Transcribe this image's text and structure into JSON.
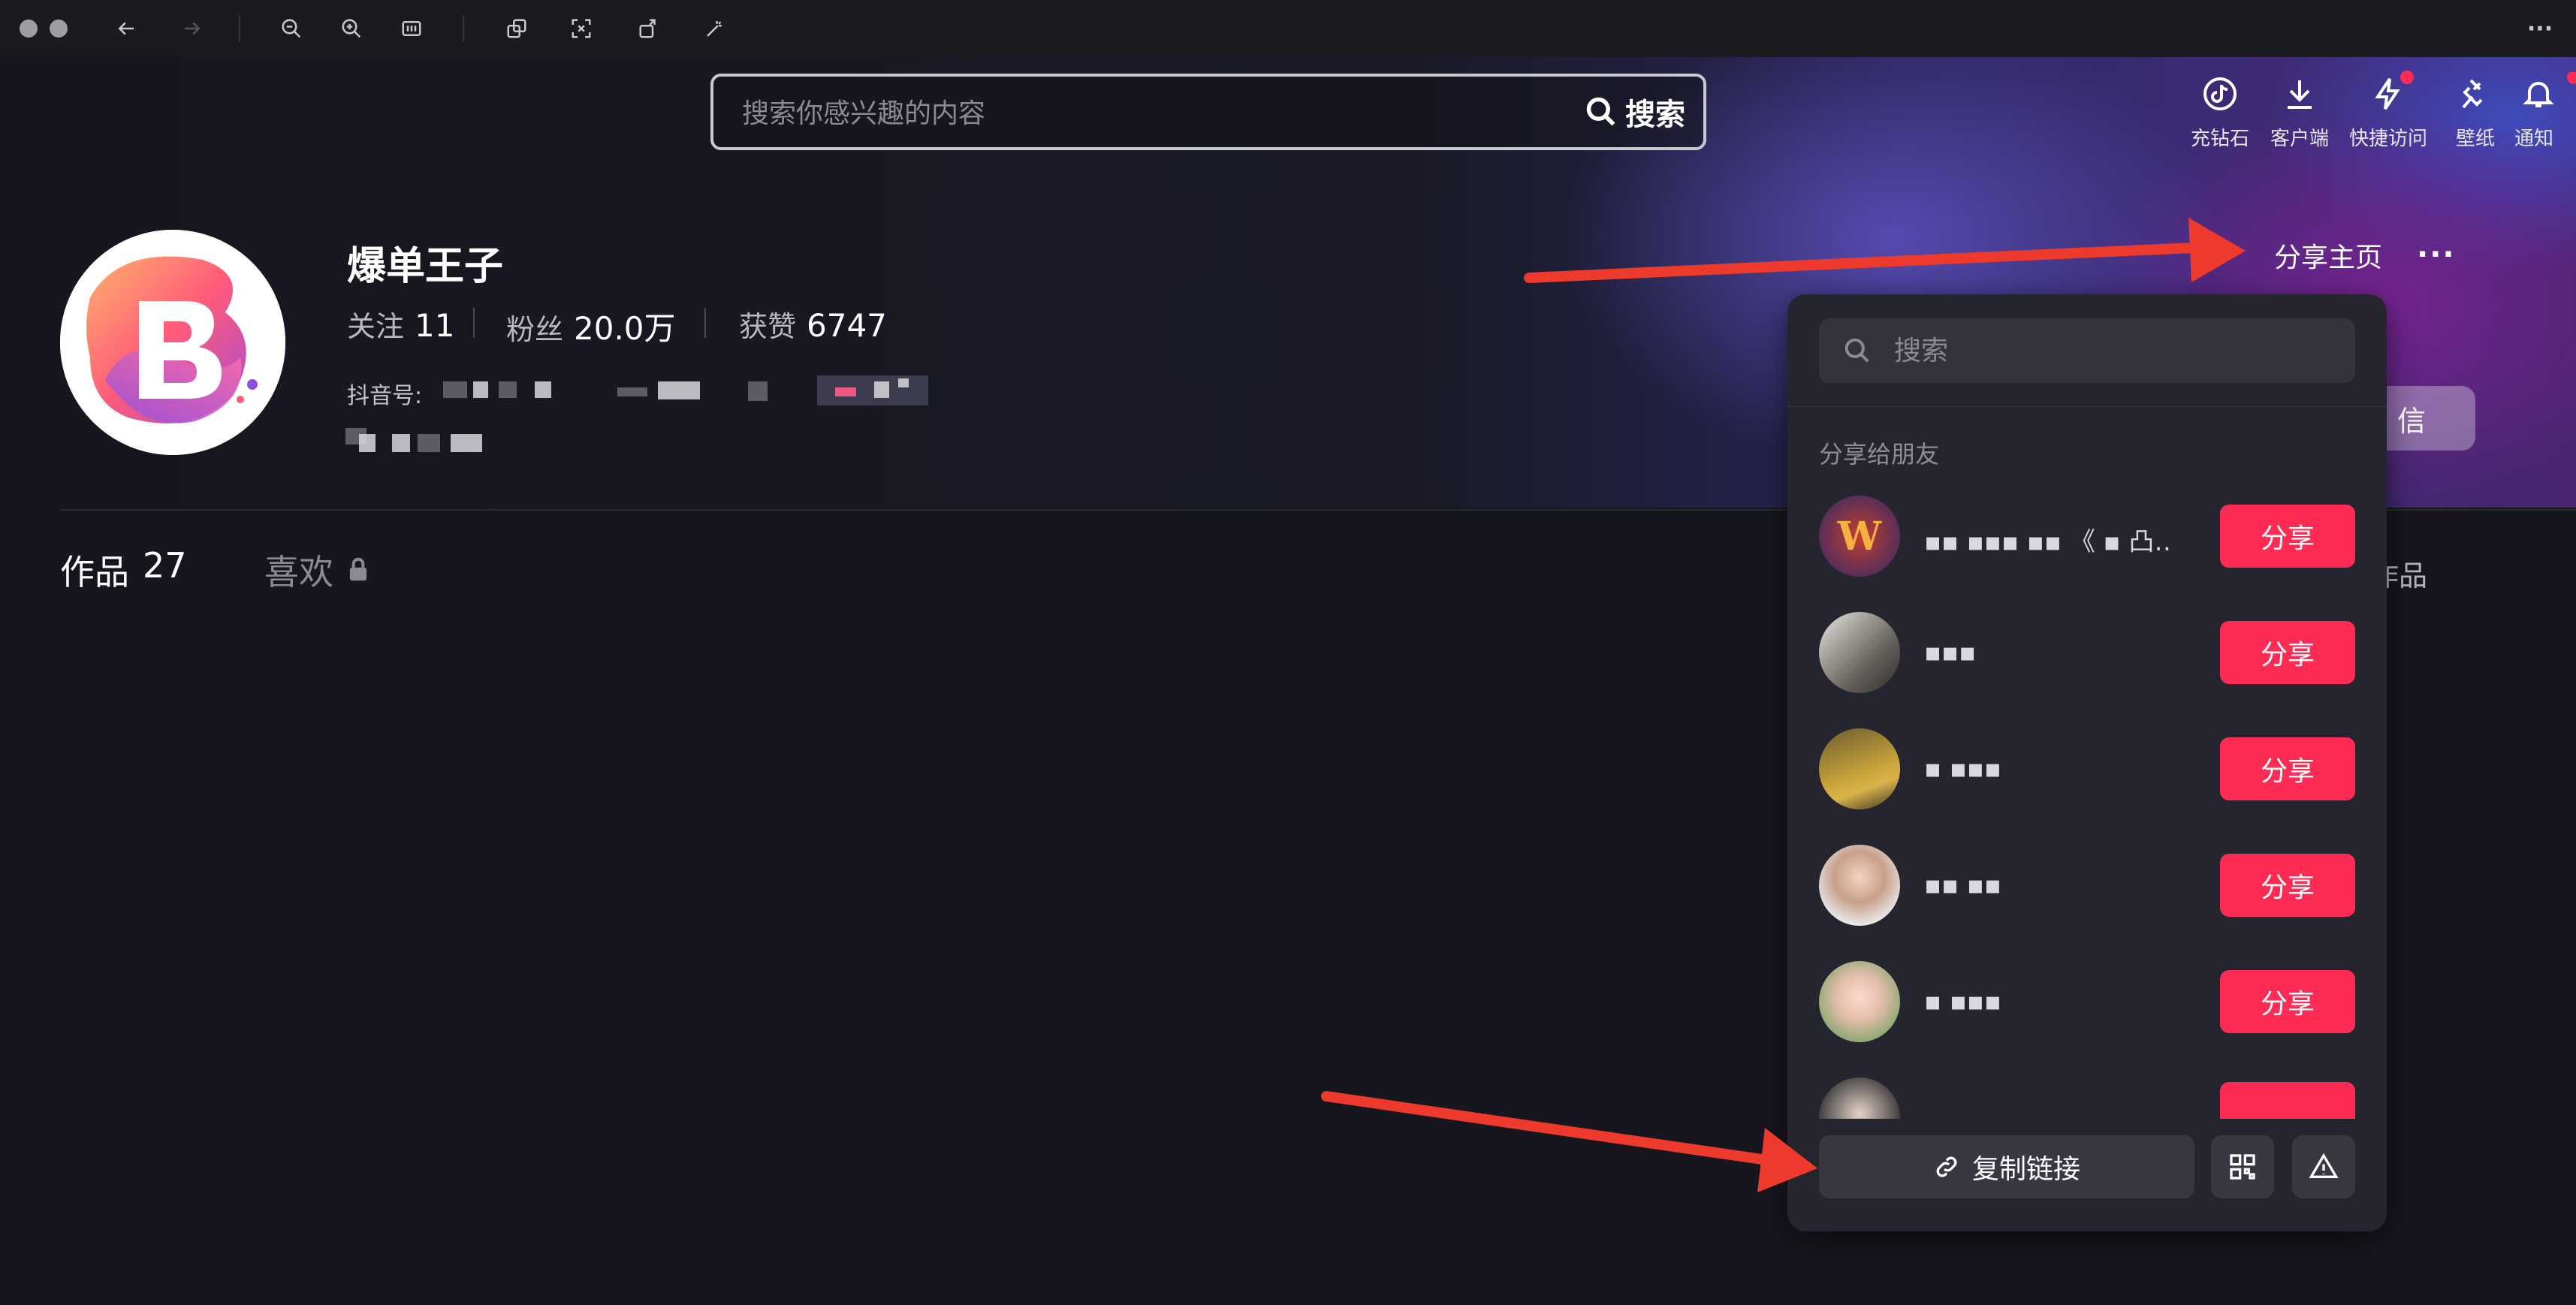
{
  "search": {
    "placeholder": "搜索你感兴趣的内容",
    "button_label": "搜索"
  },
  "top_nav": [
    {
      "label": "充钻石",
      "icon": "tiktok-coin-icon"
    },
    {
      "label": "客户端",
      "icon": "download-icon"
    },
    {
      "label": "快捷访问",
      "icon": "lightning-icon",
      "badge": true
    },
    {
      "label": "壁纸",
      "icon": "pin-icon"
    },
    {
      "label": "通知",
      "icon": "bell-icon",
      "badge": true
    }
  ],
  "profile": {
    "nickname": "爆单王子",
    "stats": {
      "following_label": "关注",
      "following_value": "11",
      "followers_label": "粉丝",
      "followers_value": "20.0万",
      "likes_label": "获赞",
      "likes_value": "6747"
    },
    "douyin_id_label": "抖音号:",
    "share_home_label": "分享主页",
    "more_label": "···",
    "message_label": "信"
  },
  "tabs": {
    "works_label": "作品",
    "works_count": "27",
    "likes_label": "喜欢",
    "right_text": "的作品"
  },
  "share_popup": {
    "search_placeholder": "搜索",
    "section_title": "分享给朋友",
    "friends": [
      {
        "name": "▪▪ ▪▪▪ ▪▪ 《 ▪ 凸…",
        "share_label": "分享"
      },
      {
        "name": "▪▪▪",
        "share_label": "分享"
      },
      {
        "name": "▪ ▪▪▪",
        "share_label": "分享"
      },
      {
        "name": "▪▪ ▪▪",
        "share_label": "分享"
      },
      {
        "name": "▪ ▪▪▪",
        "share_label": "分享"
      }
    ],
    "copy_link_label": "复制链接"
  },
  "colors": {
    "accent": "#fe2c55",
    "popup_bg": "#25252f",
    "annotation_arrow": "#ee3a2c"
  }
}
